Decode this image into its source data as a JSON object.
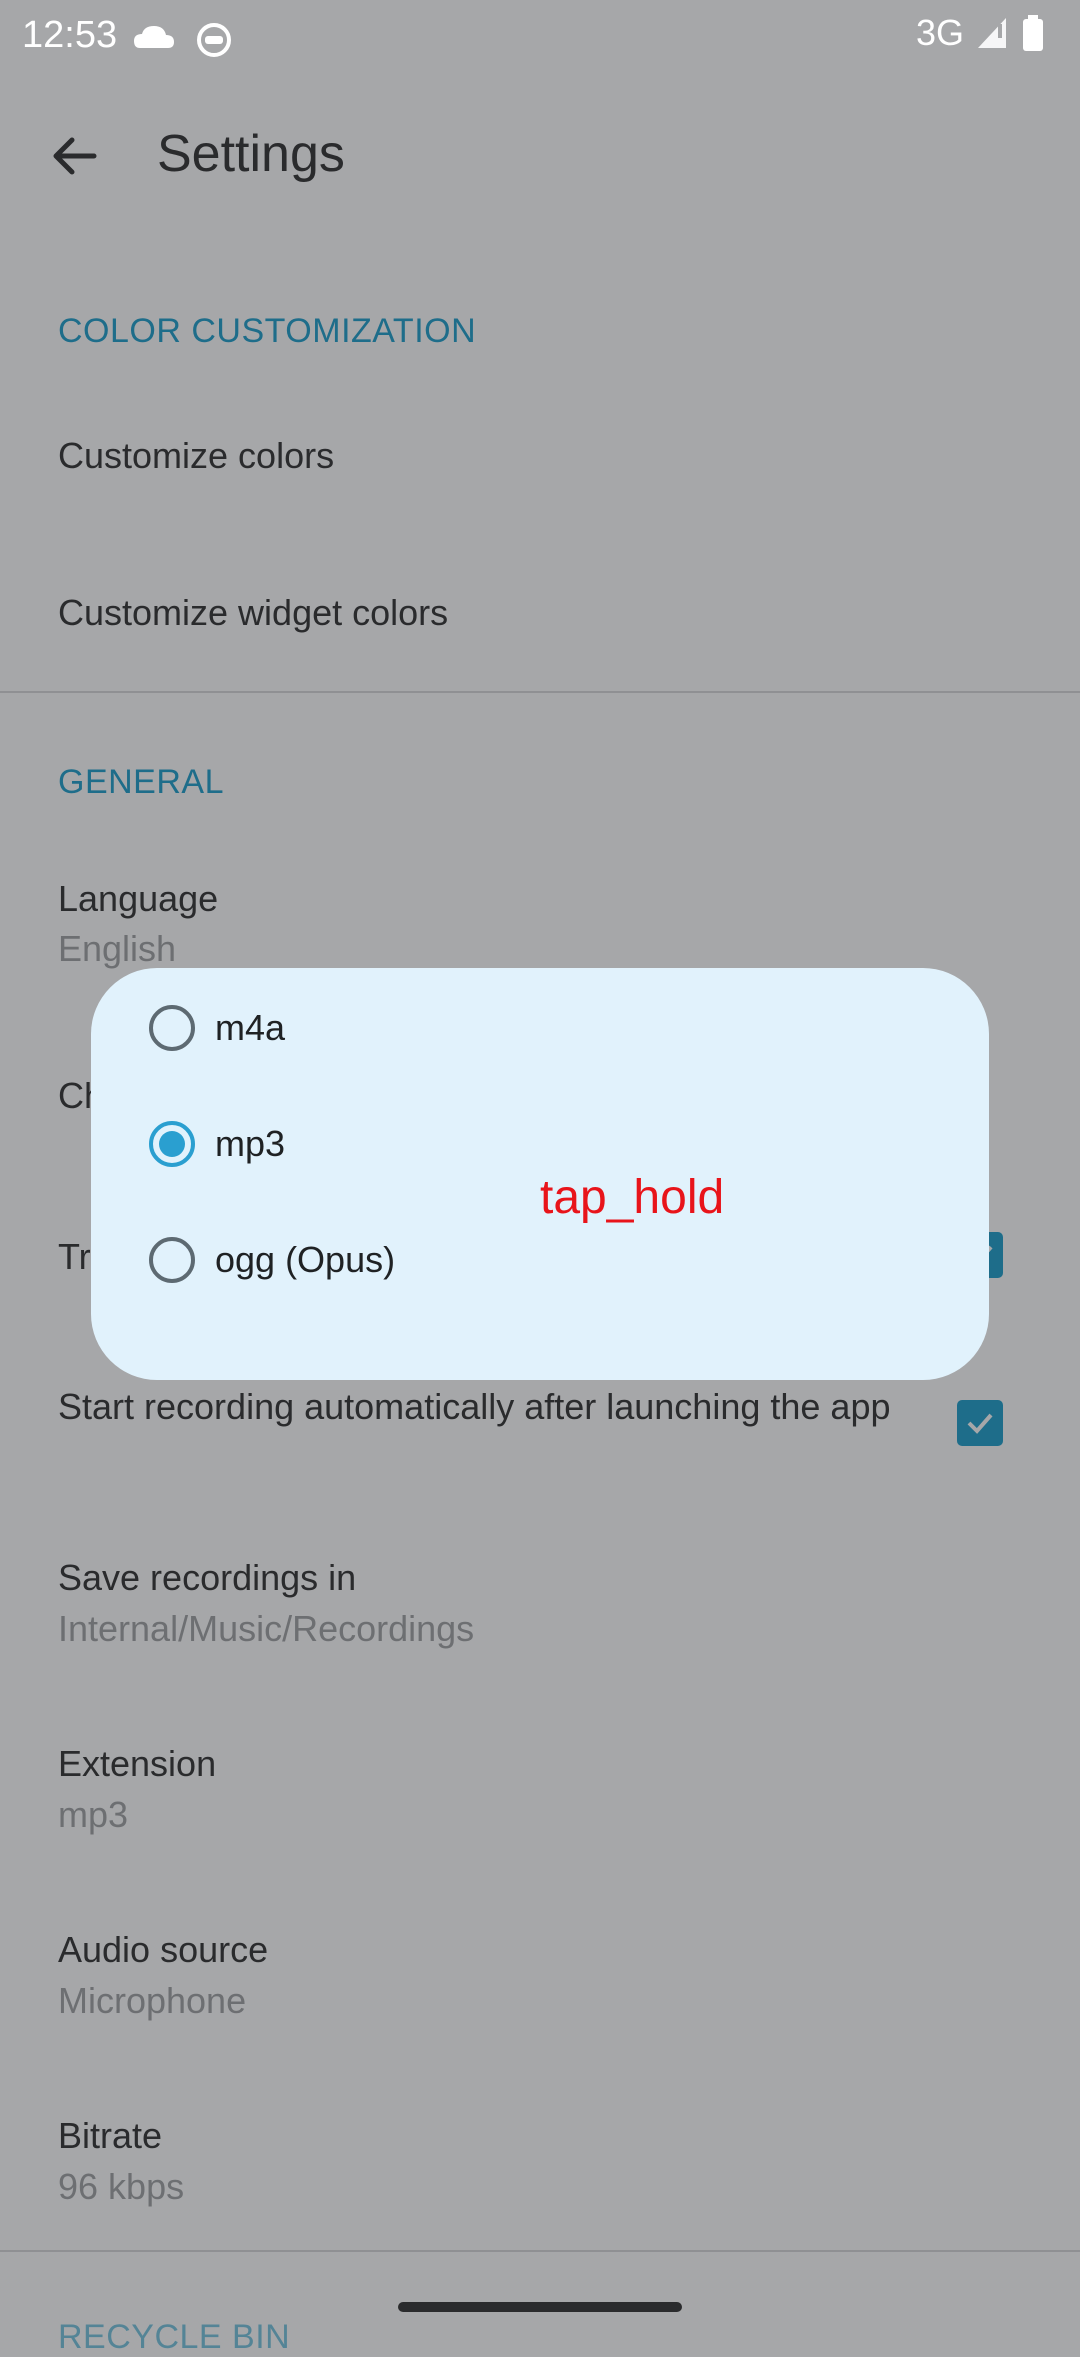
{
  "status_bar": {
    "time": "12:53",
    "network": "3G"
  },
  "toolbar": {
    "title": "Settings"
  },
  "sections": {
    "color": "COLOR CUSTOMIZATION",
    "general": "GENERAL",
    "recycle": "RECYCLE BIN"
  },
  "items": {
    "customize_colors": "Customize colors",
    "customize_widget": "Customize widget colors",
    "language_title": "Language",
    "language_value": "English",
    "hidden_row_1": "Ch",
    "hidden_row_2": "Tr",
    "start_recording": "Start recording automatically after launching the app",
    "save_title": "Save recordings in",
    "save_value": "Internal/Music/Recordings",
    "extension_title": "Extension",
    "extension_value": "mp3",
    "audio_title": "Audio source",
    "audio_value": "Microphone",
    "bitrate_title": "Bitrate",
    "bitrate_value": "96 kbps"
  },
  "dialog": {
    "options": [
      "m4a",
      "mp3",
      "ogg (Opus)"
    ],
    "selected": "mp3"
  },
  "overlay_label": "tap_hold",
  "colors": {
    "accent": "#1e6d8a",
    "radio_selected": "#2a9fd0",
    "dialog_bg": "#e1f2fc",
    "scrim_bg": "#a6a7a9"
  }
}
